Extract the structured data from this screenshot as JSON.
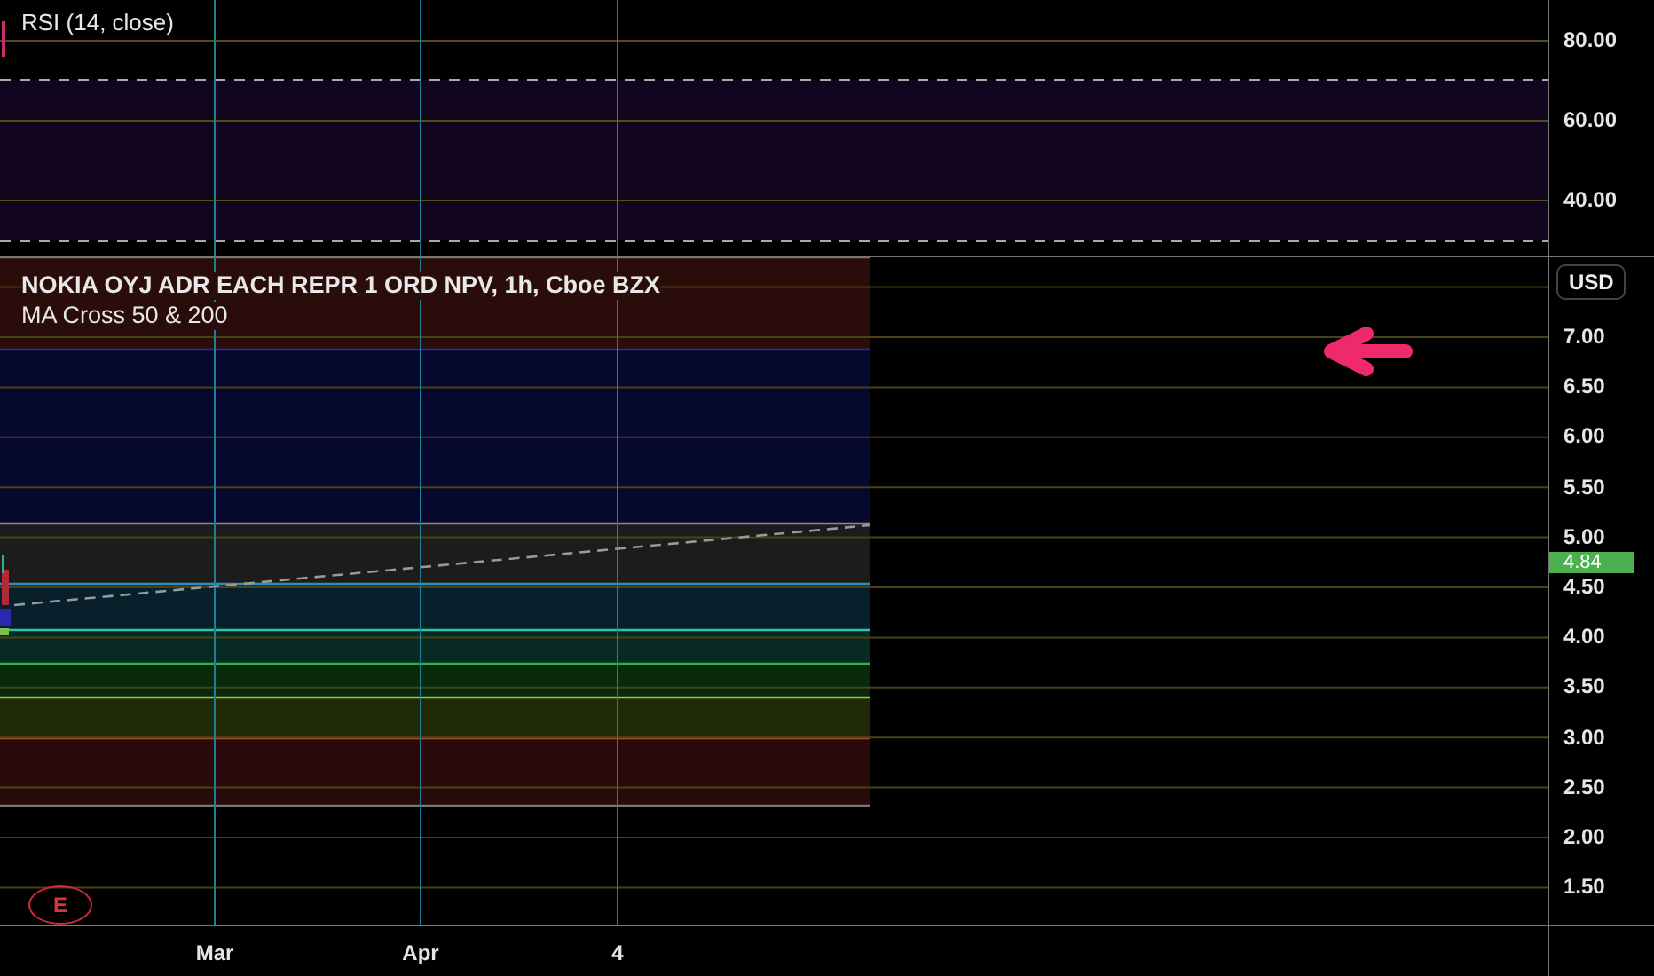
{
  "rsi_pane": {
    "title": "RSI (14, close)",
    "scale": [
      "80.00",
      "60.00",
      "40.00"
    ]
  },
  "main_pane": {
    "title": "NOKIA OYJ ADR EACH REPR 1 ORD NPV, 1h, Cboe BZX",
    "indicator": "MA Cross 50 & 200",
    "currency": "USD",
    "scale": [
      "7.00",
      "6.50",
      "6.00",
      "5.50",
      "5.00",
      "4.50",
      "4.00",
      "3.50",
      "3.00",
      "2.50",
      "2.00",
      "1.50"
    ],
    "last_price": "4.84",
    "event_badge": "E"
  },
  "time_axis": [
    "Mar",
    "Apr",
    "4"
  ]
}
